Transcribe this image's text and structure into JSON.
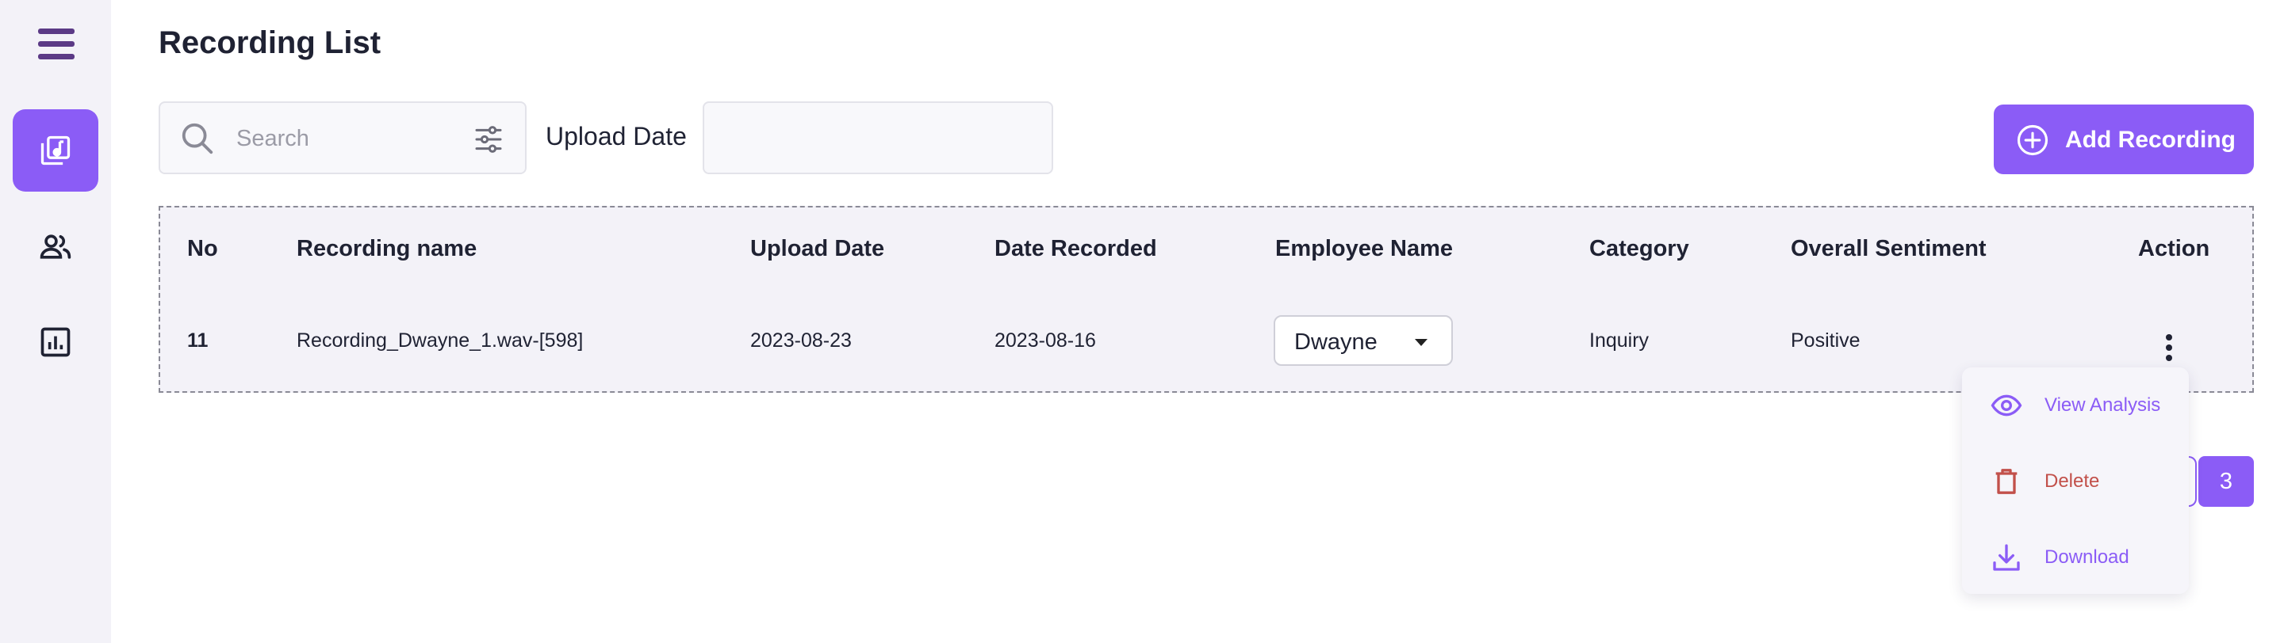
{
  "page": {
    "title": "Recording List"
  },
  "sidebar": {
    "items": [
      {
        "name": "recordings",
        "icon": "music-library-icon",
        "active": true
      },
      {
        "name": "employees",
        "icon": "people-icon",
        "active": false
      },
      {
        "name": "analytics",
        "icon": "bar-chart-icon",
        "active": false
      }
    ]
  },
  "toolbar": {
    "search_placeholder": "Search",
    "search_value": "",
    "upload_date_label": "Upload Date",
    "upload_date_value": "",
    "add_button_label": "Add Recording"
  },
  "table": {
    "headers": [
      "No",
      "Recording name",
      "Upload Date",
      "Date Recorded",
      "Employee Name",
      "Category",
      "Overall Sentiment",
      "Action"
    ],
    "rows": [
      {
        "no": "11",
        "recording_name": "Recording_Dwayne_1.wav-[598]",
        "upload_date": "2023-08-23",
        "date_recorded": "2023-08-16",
        "employee_name": "Dwayne",
        "category": "Inquiry",
        "overall_sentiment": "Positive"
      }
    ]
  },
  "action_menu": {
    "view_label": "View Analysis",
    "delete_label": "Delete",
    "download_label": "Download"
  },
  "pagination": {
    "current_page": "3"
  },
  "colors": {
    "accent": "#8b5cf6",
    "sidebar_bg": "#f3f2f8",
    "delete": "#c2504a",
    "hamburger": "#5b3a86"
  }
}
